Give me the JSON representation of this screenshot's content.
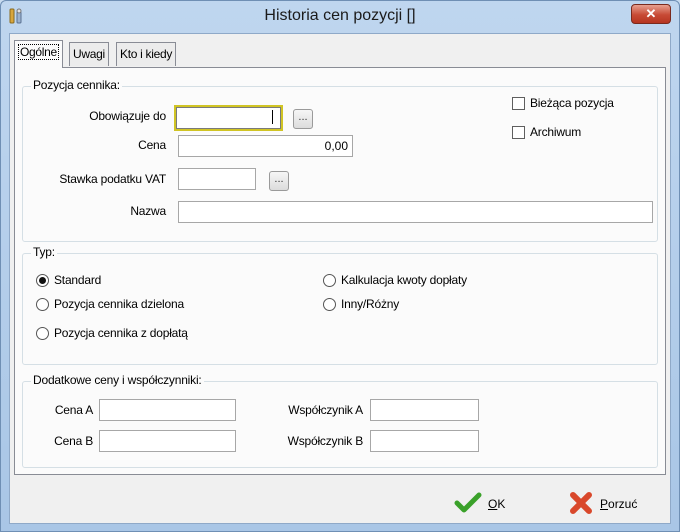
{
  "window": {
    "title": "Historia cen pozycji []",
    "close_label": "✕"
  },
  "tabs": [
    {
      "label": "Ogólne",
      "active": true
    },
    {
      "label": "Uwagi",
      "active": false
    },
    {
      "label": "Kto i kiedy",
      "active": false
    }
  ],
  "pozycja": {
    "legend": "Pozycja cennika:",
    "obowiazuje_label": "Obowiązuje do",
    "obowiazuje_value": "",
    "cena_label": "Cena",
    "cena_value": "0,00",
    "vat_label": "Stawka podatku VAT",
    "vat_value": "",
    "nazwa_label": "Nazwa",
    "nazwa_value": "",
    "dots": "...",
    "biezaca_label": "Bieżąca pozycja",
    "archiwum_label": "Archiwum"
  },
  "typ": {
    "legend": "Typ:",
    "options": [
      {
        "label": "Standard",
        "selected": true
      },
      {
        "label": "Pozycja cennika dzielona",
        "selected": false
      },
      {
        "label": "Pozycja cennika z dopłatą",
        "selected": false
      },
      {
        "label": "Kalkulacja kwoty dopłaty",
        "selected": false
      },
      {
        "label": "Inny/Różny",
        "selected": false
      }
    ]
  },
  "dodatkowe": {
    "legend": "Dodatkowe ceny i współczynniki:",
    "cena_a_label": "Cena A",
    "cena_b_label": "Cena B",
    "wsp_a_label": "Współczynik A",
    "wsp_b_label": "Współczynik B"
  },
  "footer": {
    "ok_first": "O",
    "ok_rest": "K",
    "porzuc_first": "P",
    "porzuc_rest": "orzuć"
  },
  "colors": {
    "ok_green": "#3aa12a",
    "cancel_red": "#d9482b",
    "focus_yellow": "#d0c424"
  }
}
